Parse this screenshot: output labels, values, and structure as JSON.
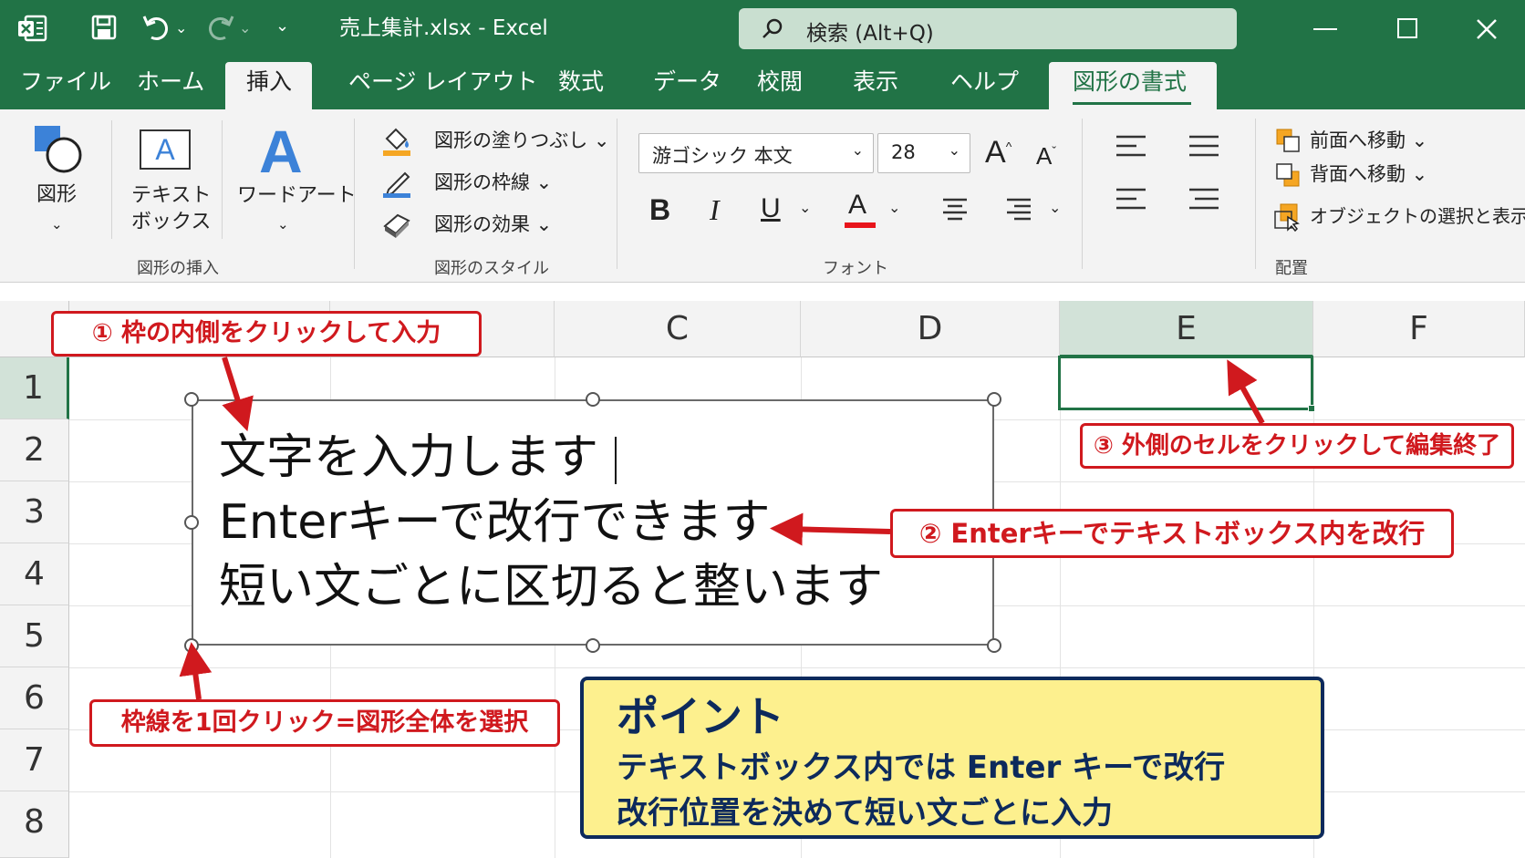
{
  "title_bar": {
    "file_title": "売上集計.xlsx  -  Excel",
    "search_label": "検索 (Alt+Q)"
  },
  "tabs": [
    "ファイル",
    "ホーム",
    "挿入",
    "ページ レイアウト",
    "数式",
    "データ",
    "校閲",
    "表示",
    "ヘルプ",
    "図形の書式"
  ],
  "active_tabs": [
    "挿入",
    "図形の書式"
  ],
  "ribbon": {
    "insert_shapes": {
      "shape_label": "図形",
      "textbox_label_1": "テキスト",
      "textbox_label_2": "ボックス",
      "wordart_label": "ワードアート",
      "group_label": "図形の挿入"
    },
    "shape_styles": {
      "fill": "図形の塗りつぶし",
      "outline": "図形の枠線",
      "effects": "図形の効果",
      "group_label": "図形のスタイル"
    },
    "font": {
      "font_name": "游ゴシック 本文",
      "font_size": "28",
      "group_label": "フォント"
    },
    "arrange": {
      "bring_forward": "前面へ移動",
      "send_backward": "背面へ移動",
      "selection_pane": "オブジェクトの選択と表示",
      "group_label": "配置"
    }
  },
  "sheet": {
    "columns": [
      "C",
      "D",
      "E",
      "F"
    ],
    "rows": [
      "1",
      "2",
      "3",
      "4",
      "5",
      "6",
      "7",
      "8"
    ],
    "selected_cell": "E1"
  },
  "textbox": {
    "lines": [
      "文字を入力します",
      "Enterキーで改行できます",
      "短い文ごとに区切ると整います"
    ]
  },
  "callouts": {
    "c1": "① 枠の内側をクリックして入力",
    "c2": "② Enterキーでテキストボックス内を改行",
    "c3": "③ 外側のセルをクリックして編集終了",
    "c4": "枠線を1回クリック=図形全体を選択"
  },
  "point_box": {
    "title": "ポイント",
    "line1": "テキストボックス内では Enter キーで改行",
    "line2": "改行位置を決めて短い文ごとに入力"
  },
  "colors": {
    "excel_green": "#217346",
    "callout_red": "#d0191e",
    "point_bg": "#fdf08e",
    "point_border": "#0d2a5c"
  }
}
